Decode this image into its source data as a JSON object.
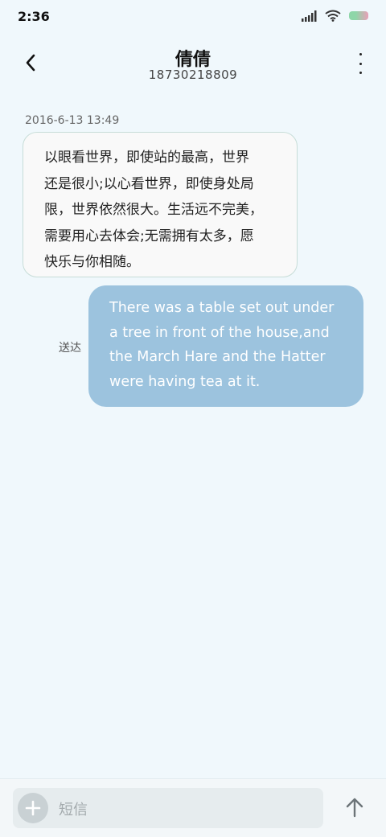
{
  "status_bar": {
    "time": "2:36"
  },
  "header": {
    "contact_name": "倩倩",
    "phone_number": "18730218809"
  },
  "messages": {
    "timestamp": "2016-6-13 13:49",
    "incoming_lines": [
      "以眼看世界，即使站的最高，世界",
      "还是很小;以心看世界，即使身处局",
      "限，世界依然很大。生活远不完美，",
      "需要用心去体会;无需拥有太多，愿",
      "快乐与你相随。"
    ],
    "outgoing_lines": [
      "There was a table set out under",
      "a tree in front of the house,and",
      "the March Hare and the Hatter",
      "were having tea at it."
    ],
    "outgoing_status": "送达"
  },
  "composer": {
    "placeholder": "短信"
  },
  "colors": {
    "background": "#f0f8fc",
    "outgoing_bubble": "#9cc3de",
    "incoming_bubble": "#f9f9f9"
  },
  "icons": [
    "signal-icon",
    "wifi-icon",
    "battery-icon",
    "back-arrow-icon",
    "more-options-icon",
    "plus-icon",
    "send-arrow-icon"
  ]
}
